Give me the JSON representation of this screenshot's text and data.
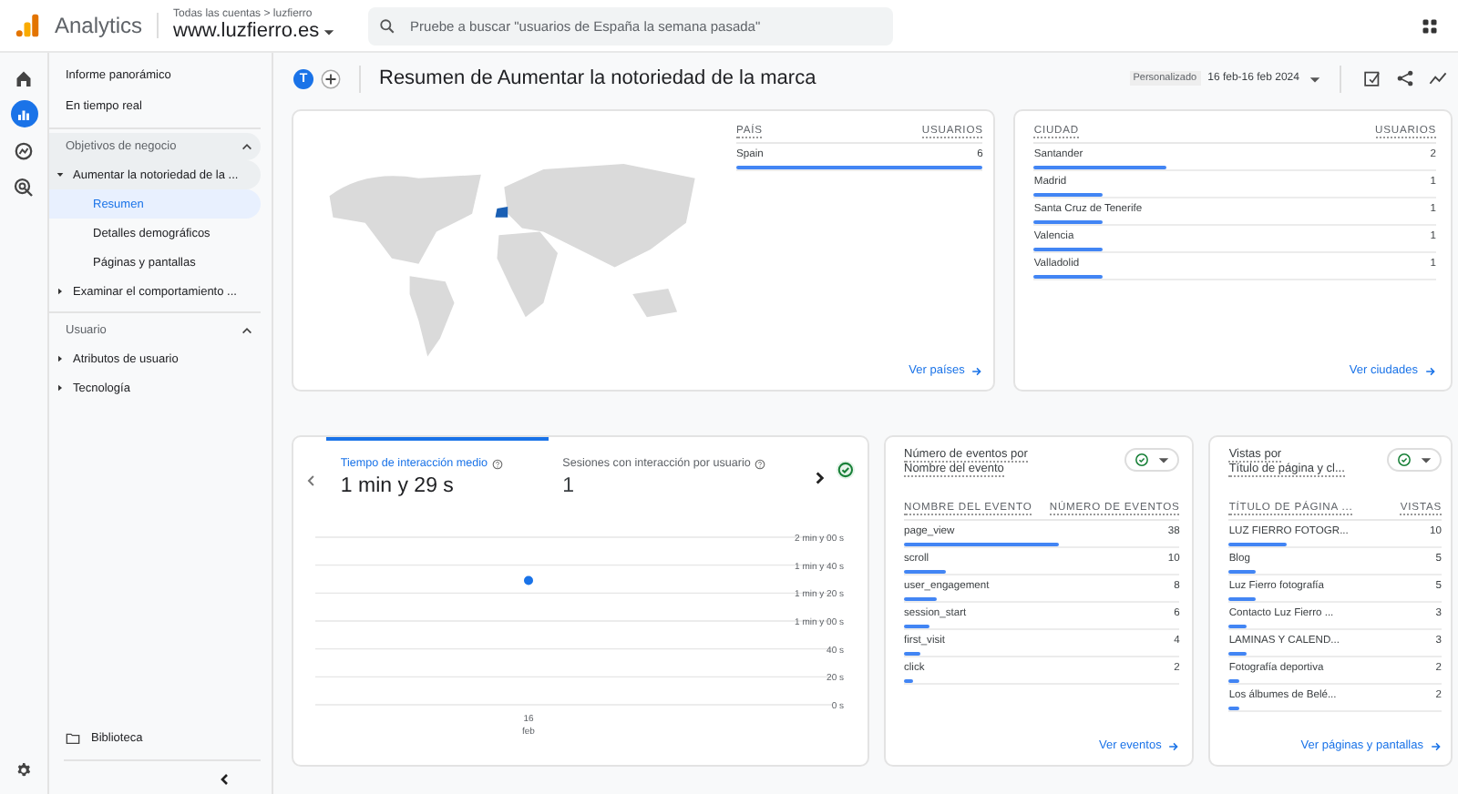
{
  "header": {
    "product": "Analytics",
    "breadcrumb": "Todas las cuentas > luzfierro",
    "property": "www.luzfierro.es",
    "search": {
      "placeholder": "Pruebe a buscar \"usuarios de España la semana pasada\""
    }
  },
  "rail": [
    {
      "kind": "home",
      "selected": false
    },
    {
      "kind": "reports",
      "selected": true
    },
    {
      "kind": "explore",
      "selected": false
    },
    {
      "kind": "advertising",
      "selected": false
    }
  ],
  "sidebar": {
    "top_items": [
      {
        "label": "Informe panorámico",
        "selected": false
      },
      {
        "label": "En tiempo real",
        "selected": false
      }
    ],
    "sections": [
      {
        "label": "Objetivos de negocio",
        "expanded": true,
        "active": true,
        "items": [
          {
            "label": "Aumentar la notoriedad de la ...",
            "expanded": true,
            "active": true,
            "children": [
              {
                "label": "Resumen",
                "selected": true
              },
              {
                "label": "Detalles demográficos",
                "selected": false
              },
              {
                "label": "Páginas y pantallas",
                "selected": false
              }
            ]
          },
          {
            "label": "Examinar el comportamiento ...",
            "expanded": false,
            "active": false
          }
        ]
      },
      {
        "label": "Usuario",
        "expanded": true,
        "active": false,
        "items": [
          {
            "label": "Atributos de usuario",
            "expanded": false,
            "active": false
          },
          {
            "label": "Tecnología",
            "expanded": false,
            "active": false
          }
        ]
      }
    ],
    "library": "Biblioteca"
  },
  "titlebar": {
    "avatar": "T",
    "title": "Resumen de Aumentar la notoriedad de la marca",
    "date_label": "Personalizado",
    "date_range": "16 feb-16 feb 2024"
  },
  "country_card": {
    "columns": [
      "PAÍS",
      "USUARIOS"
    ],
    "rows": [
      {
        "name": "Spain",
        "value": "6",
        "level": 1
      }
    ],
    "link": "Ver países"
  },
  "city_card": {
    "columns": [
      "CIUDAD",
      "USUARIOS"
    ],
    "rows": [
      {
        "name": "Santander",
        "value": "2",
        "level": 0.33
      },
      {
        "name": "Madrid",
        "value": "1",
        "level": 0.17
      },
      {
        "name": "Santa Cruz de Tenerife",
        "value": "1",
        "level": 0.17
      },
      {
        "name": "Valencia",
        "value": "1",
        "level": 0.17
      },
      {
        "name": "Valladolid",
        "value": "1",
        "level": 0.17
      }
    ],
    "link": "Ver ciudades"
  },
  "metric_card": {
    "tabs": [
      {
        "label": "Tiempo de interacción medio",
        "value": "1 min y 29 s",
        "selected": true
      },
      {
        "label": "Sesiones con interacción por usuario",
        "value": "1",
        "selected": false
      }
    ],
    "chart_data": {
      "type": "scatter",
      "grid": true,
      "categories": [
        "16 feb"
      ],
      "series": [
        {
          "color": "#1a73e8",
          "values": [
            89
          ]
        }
      ],
      "ylim": [
        0,
        120
      ],
      "yticks": [
        {
          "value": 0,
          "label": "0 s"
        },
        {
          "value": 20,
          "label": "20 s"
        },
        {
          "value": 40,
          "label": "40 s"
        },
        {
          "value": 60,
          "label": "1 min y 00 s"
        },
        {
          "value": 80,
          "label": "1 min y 20 s"
        },
        {
          "value": 100,
          "label": "1 min y 40 s"
        },
        {
          "value": 120,
          "label": "2 min y 00 s"
        }
      ]
    }
  },
  "events_card": {
    "title_lines": [
      "Número de eventos por",
      "Nombre del evento"
    ],
    "columns": [
      "NOMBRE DEL EVENTO",
      "NÚMERO DE EVENTOS"
    ],
    "rows": [
      {
        "name": "page_view",
        "value": "38",
        "level": 0.56
      },
      {
        "name": "scroll",
        "value": "10",
        "level": 0.15
      },
      {
        "name": "user_engagement",
        "value": "8",
        "level": 0.12
      },
      {
        "name": "session_start",
        "value": "6",
        "level": 0.09
      },
      {
        "name": "first_visit",
        "value": "4",
        "level": 0.06
      },
      {
        "name": "click",
        "value": "2",
        "level": 0.03
      }
    ],
    "link": "Ver eventos"
  },
  "views_card": {
    "title_lines": [
      "Vistas por",
      "Título de página y cl..."
    ],
    "columns": [
      "TÍTULO DE PÁGINA ...",
      "VISTAS"
    ],
    "rows": [
      {
        "name": "LUZ FIERRO FOTOGR...",
        "value": "10",
        "level": 0.27
      },
      {
        "name": "Blog",
        "value": "5",
        "level": 0.13
      },
      {
        "name": "Luz Fierro fotografía",
        "value": "5",
        "level": 0.13
      },
      {
        "name": "Contacto Luz Fierro ...",
        "value": "3",
        "level": 0.08
      },
      {
        "name": "LAMINAS Y CALEND...",
        "value": "3",
        "level": 0.08
      },
      {
        "name": "Fotografía deportiva",
        "value": "2",
        "level": 0.05
      },
      {
        "name": "Los álbumes de Belé...",
        "value": "2",
        "level": 0.05
      }
    ],
    "link": "Ver páginas y pantallas"
  }
}
